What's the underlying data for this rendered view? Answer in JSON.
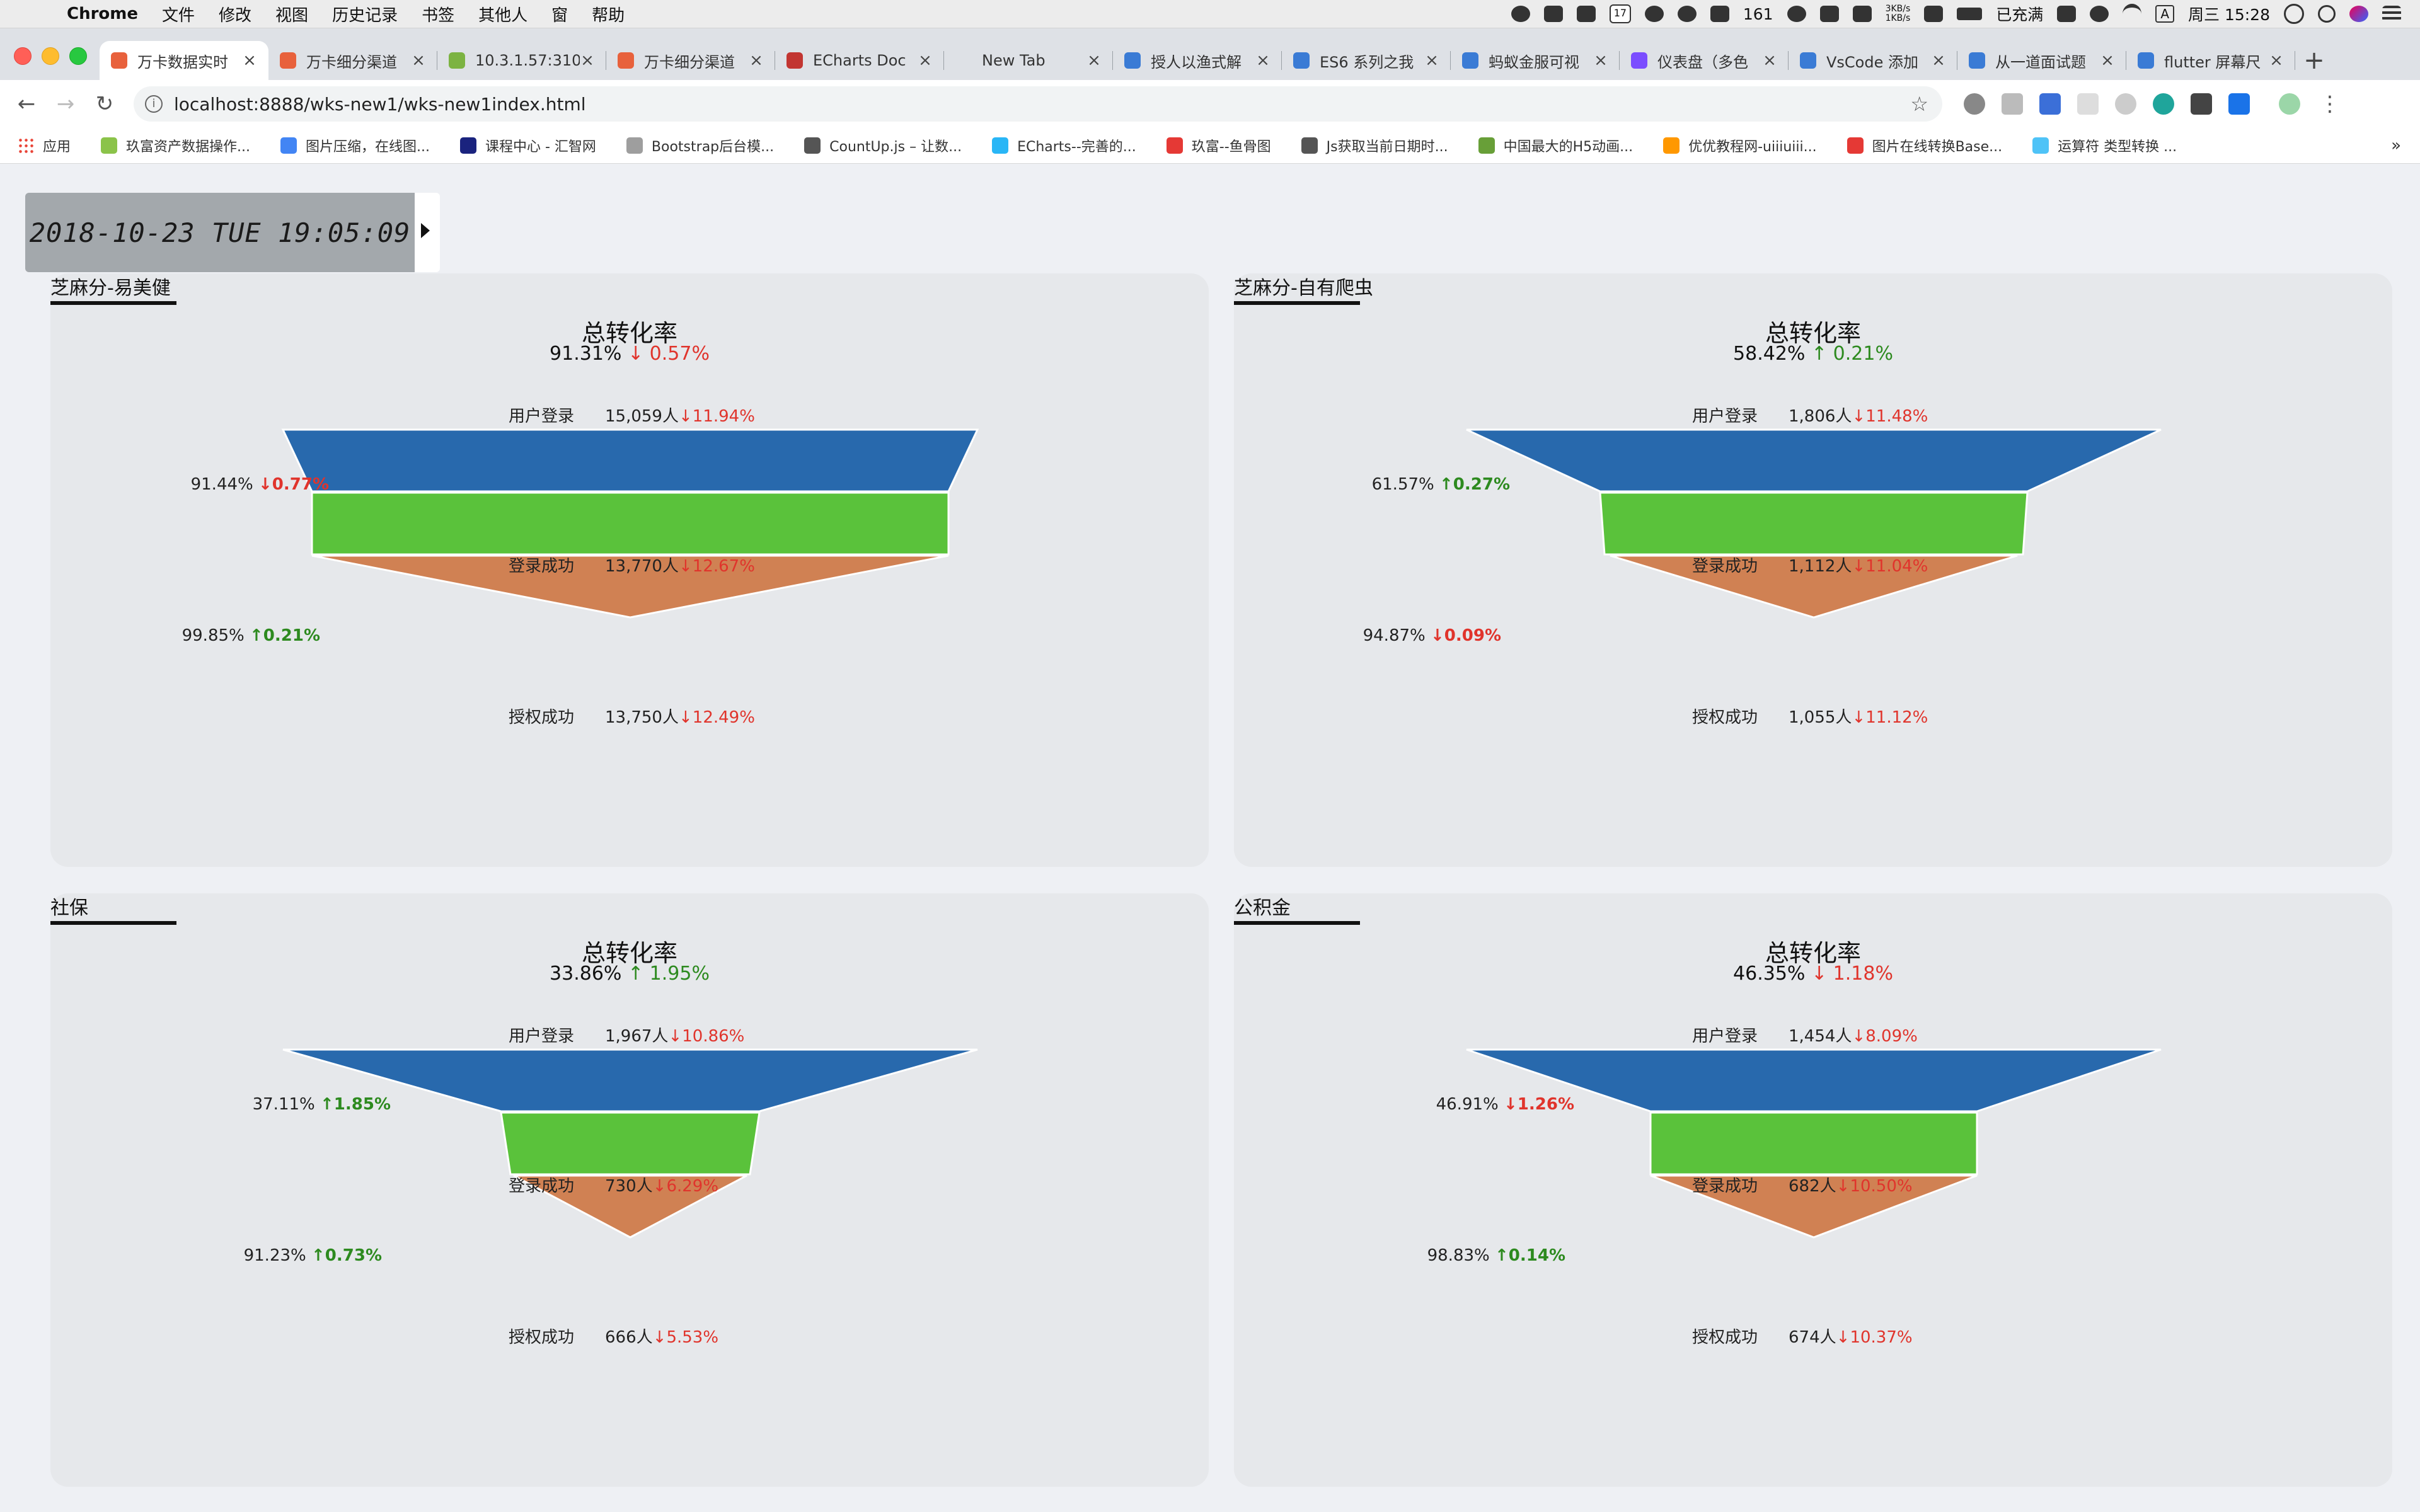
{
  "menubar": {
    "app_name": "Chrome",
    "menus": [
      "文件",
      "修改",
      "视图",
      "历史记录",
      "书签",
      "其他人",
      "窗",
      "帮助"
    ],
    "status": {
      "badge_count": "161",
      "net_up": "3KB/s",
      "net_down": "1KB/s",
      "battery": "已充满",
      "input_method": "A",
      "datetime": "周三 15:28",
      "calendar_day": "17"
    }
  },
  "tabs": [
    {
      "title": "万卡数据实时",
      "active": true,
      "favicon_color": "#e8613c"
    },
    {
      "title": "万卡细分渠道",
      "active": false,
      "favicon_color": "#e8613c"
    },
    {
      "title": "10.3.1.57:310",
      "active": false,
      "favicon_color": "#7cb342"
    },
    {
      "title": "万卡细分渠道",
      "active": false,
      "favicon_color": "#e8613c"
    },
    {
      "title": "ECharts Doc",
      "active": false,
      "favicon_color": "#c23531"
    },
    {
      "title": "New Tab",
      "active": false,
      "favicon_color": "#00000000"
    },
    {
      "title": "授人以渔式解",
      "active": false,
      "favicon_color": "#3a7bd5"
    },
    {
      "title": "ES6 系列之我",
      "active": false,
      "favicon_color": "#3a7bd5"
    },
    {
      "title": "蚂蚁金服可视",
      "active": false,
      "favicon_color": "#3a7bd5"
    },
    {
      "title": "仪表盘（多色",
      "active": false,
      "favicon_color": "#7b4dff"
    },
    {
      "title": "VsCode 添加",
      "active": false,
      "favicon_color": "#3a7bd5"
    },
    {
      "title": "从一道面试题",
      "active": false,
      "favicon_color": "#3a7bd5"
    },
    {
      "title": "flutter 屏幕尺",
      "active": false,
      "favicon_color": "#3a7bd5"
    }
  ],
  "toolbar": {
    "url": "localhost:8888/wks-new1/wks-new1index.html"
  },
  "bookmarks": [
    {
      "label": "应用",
      "color": "#e94235"
    },
    {
      "label": "玖富资产数据操作...",
      "color": "#8bc34a"
    },
    {
      "label": "图片压缩，在线图...",
      "color": "#4285f4"
    },
    {
      "label": "课程中心 - 汇智网",
      "color": "#1a237e"
    },
    {
      "label": "Bootstrap后台模...",
      "color": "#9e9e9e"
    },
    {
      "label": "CountUp.js – 让数...",
      "color": "#555555"
    },
    {
      "label": "ECharts--完善的...",
      "color": "#29b6f6"
    },
    {
      "label": "玖富--鱼骨图",
      "color": "#e53935"
    },
    {
      "label": "Js获取当前日期时...",
      "color": "#555555"
    },
    {
      "label": "中国最大的H5动画...",
      "color": "#689f38"
    },
    {
      "label": "优优教程网-uiiiuiii...",
      "color": "#ff9800"
    },
    {
      "label": "图片在线转换Base...",
      "color": "#e53935"
    },
    {
      "label": "运算符 类型转换 ...",
      "color": "#4fc3f7"
    }
  ],
  "clock": {
    "text": "2018-10-23 TUE 19:05:09"
  },
  "colors": {
    "stage1": "#2869ad",
    "stage2": "#5ac23b",
    "stage3": "#d08153",
    "down": "#e0342c",
    "up": "#2d8a1f"
  },
  "panels": [
    {
      "title": "芝麻分-易美健",
      "chart_title": "总转化率",
      "total_rate": "91.31%",
      "total_dir": "down",
      "total_change": "0.57%",
      "stages": [
        {
          "label": "用户登录",
          "value": "15,059人",
          "dir": "down",
          "change": "11.94%"
        },
        {
          "label": "登录成功",
          "value": "13,770人",
          "dir": "down",
          "change": "12.67%"
        },
        {
          "label": "授权成功",
          "value": "13,750人",
          "dir": "down",
          "change": "12.49%"
        }
      ],
      "conversions": [
        {
          "rate": "91.44%",
          "dir": "down",
          "change": "0.77%"
        },
        {
          "rate": "99.85%",
          "dir": "up",
          "change": "0.21%"
        }
      ]
    },
    {
      "title": "芝麻分-自有爬虫",
      "chart_title": "总转化率",
      "total_rate": "58.42%",
      "total_dir": "up",
      "total_change": "0.21%",
      "stages": [
        {
          "label": "用户登录",
          "value": "1,806人",
          "dir": "down",
          "change": "11.48%"
        },
        {
          "label": "登录成功",
          "value": "1,112人",
          "dir": "down",
          "change": "11.04%"
        },
        {
          "label": "授权成功",
          "value": "1,055人",
          "dir": "down",
          "change": "11.12%"
        }
      ],
      "conversions": [
        {
          "rate": "61.57%",
          "dir": "up",
          "change": "0.27%"
        },
        {
          "rate": "94.87%",
          "dir": "down",
          "change": "0.09%"
        }
      ]
    },
    {
      "title": "社保",
      "chart_title": "总转化率",
      "total_rate": "33.86%",
      "total_dir": "up",
      "total_change": "1.95%",
      "stages": [
        {
          "label": "用户登录",
          "value": "1,967人",
          "dir": "down",
          "change": "10.86%"
        },
        {
          "label": "登录成功",
          "value": "730人",
          "dir": "down",
          "change": "6.29%"
        },
        {
          "label": "授权成功",
          "value": "666人",
          "dir": "down",
          "change": "5.53%"
        }
      ],
      "conversions": [
        {
          "rate": "37.11%",
          "dir": "up",
          "change": "1.85%"
        },
        {
          "rate": "91.23%",
          "dir": "up",
          "change": "0.73%"
        }
      ]
    },
    {
      "title": "公积金",
      "chart_title": "总转化率",
      "total_rate": "46.35%",
      "total_dir": "down",
      "total_change": "1.18%",
      "stages": [
        {
          "label": "用户登录",
          "value": "1,454人",
          "dir": "down",
          "change": "8.09%"
        },
        {
          "label": "登录成功",
          "value": "682人",
          "dir": "down",
          "change": "10.50%"
        },
        {
          "label": "授权成功",
          "value": "674人",
          "dir": "down",
          "change": "10.37%"
        }
      ],
      "conversions": [
        {
          "rate": "46.91%",
          "dir": "down",
          "change": "1.26%"
        },
        {
          "rate": "98.83%",
          "dir": "up",
          "change": "0.14%"
        }
      ]
    }
  ],
  "chart_data": [
    {
      "type": "funnel",
      "title": "总转化率",
      "categories": [
        "用户登录",
        "登录成功",
        "授权成功"
      ],
      "values": [
        15059,
        13770,
        13750
      ]
    },
    {
      "type": "funnel",
      "title": "总转化率",
      "categories": [
        "用户登录",
        "登录成功",
        "授权成功"
      ],
      "values": [
        1806,
        1112,
        1055
      ]
    },
    {
      "type": "funnel",
      "title": "总转化率",
      "categories": [
        "用户登录",
        "登录成功",
        "授权成功"
      ],
      "values": [
        1967,
        730,
        666
      ]
    },
    {
      "type": "funnel",
      "title": "总转化率",
      "categories": [
        "用户登录",
        "登录成功",
        "授权成功"
      ],
      "values": [
        1454,
        682,
        674
      ]
    }
  ]
}
